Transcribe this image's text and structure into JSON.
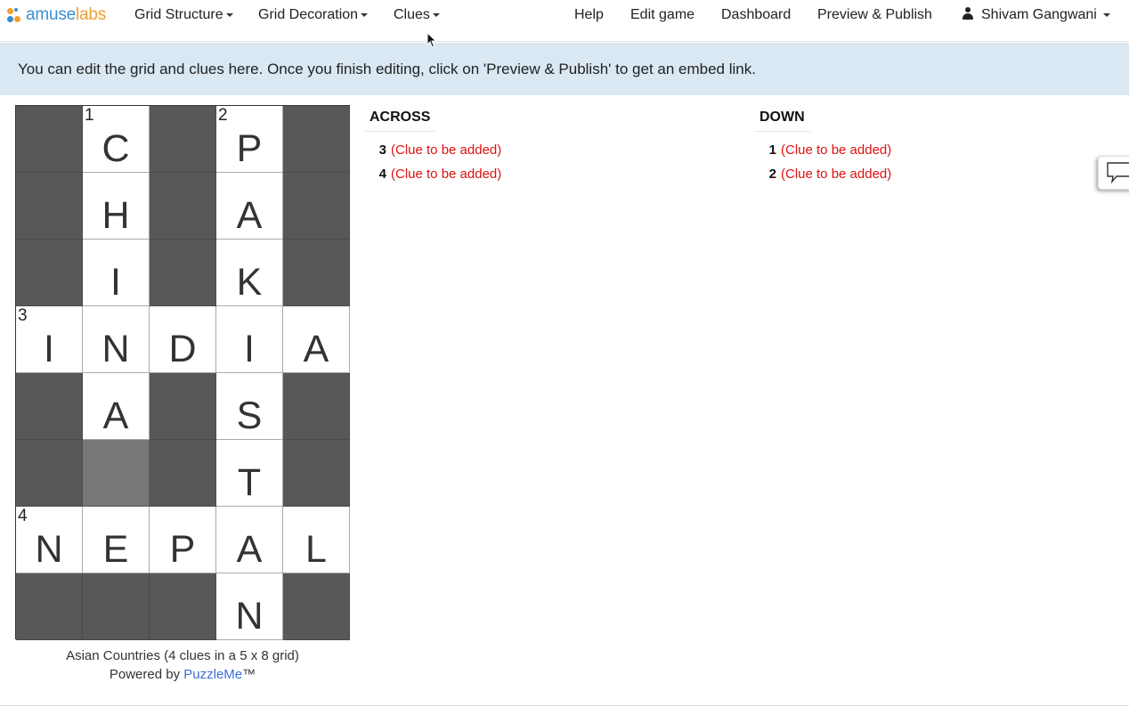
{
  "brand": {
    "amuse": "amuse",
    "labs": "labs"
  },
  "nav": {
    "grid_structure": "Grid Structure",
    "grid_decoration": "Grid Decoration",
    "clues": "Clues",
    "help": "Help",
    "edit_game": "Edit game",
    "dashboard": "Dashboard",
    "preview_publish": "Preview & Publish",
    "user": "Shivam Gangwani"
  },
  "banner": "You can edit the grid and clues here. Once you finish editing, click on 'Preview & Publish' to get an embed link.",
  "grid": {
    "cols": 5,
    "rows": 8,
    "cells": [
      [
        "#",
        "1C",
        "#",
        "2P",
        "#"
      ],
      [
        "#",
        "H",
        "#",
        "A",
        "#"
      ],
      [
        "#",
        "I",
        "#",
        "K",
        "#"
      ],
      [
        "3I",
        "N",
        "D",
        "I",
        "A"
      ],
      [
        "#",
        "A",
        "#",
        "S",
        "#"
      ],
      [
        "#",
        "~",
        "#",
        "T",
        "#"
      ],
      [
        "4N",
        "E",
        "P",
        "A",
        "L"
      ],
      [
        "#",
        "#",
        "#",
        "N",
        "#"
      ]
    ]
  },
  "caption": {
    "title": "Asian Countries (4 clues in a 5 x 8 grid)",
    "powered_by": "Powered by",
    "puzzleme": "PuzzleMe",
    "tm": "™"
  },
  "clues": {
    "across_heading": "ACROSS",
    "down_heading": "DOWN",
    "across": [
      {
        "num": "3",
        "text": "(Clue to be added)"
      },
      {
        "num": "4",
        "text": "(Clue to be added)"
      }
    ],
    "down": [
      {
        "num": "1",
        "text": "(Clue to be added)"
      },
      {
        "num": "2",
        "text": "(Clue to be added)"
      }
    ]
  },
  "colors": {
    "clue_placeholder": "#e01010",
    "banner_bg": "#d9e8f3",
    "block": "#585858",
    "link": "#3a6fd8"
  },
  "icons": {
    "user": "user-icon",
    "feedback": "speech-bubble-icon",
    "caret": "caret-down-icon"
  }
}
